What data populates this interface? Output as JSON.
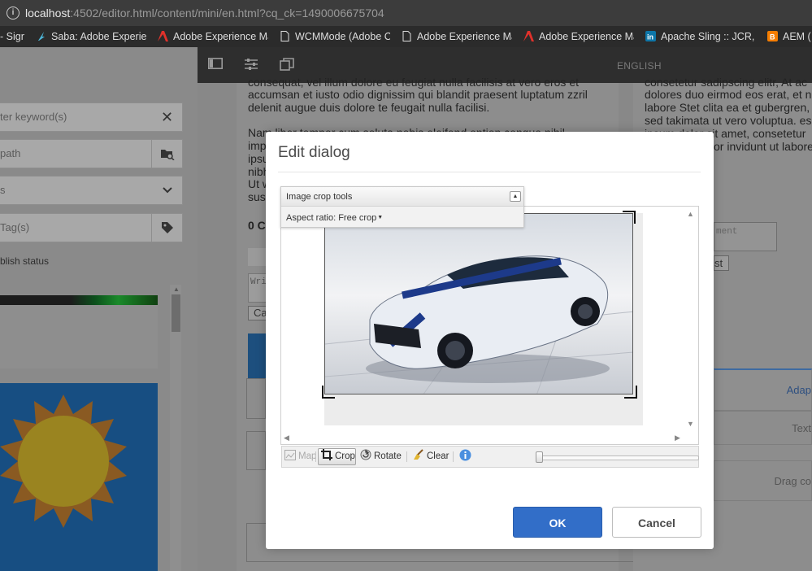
{
  "browser": {
    "url_host": "localhost",
    "url_path": ":4502/editor.html/content/mini/en.html?cq_ck=1490006675704",
    "bookmarks": [
      {
        "label": "- Sign",
        "icon": "none"
      },
      {
        "label": "Saba: Adobe Experien",
        "icon": "saba-icon"
      },
      {
        "label": "Adobe Experience Ma",
        "icon": "adobe-icon"
      },
      {
        "label": "WCMMode (Adobe C",
        "icon": "page-icon"
      },
      {
        "label": "Adobe Experience Ma",
        "icon": "page-icon"
      },
      {
        "label": "Adobe Experience Ma",
        "icon": "adobe-icon"
      },
      {
        "label": "Apache Sling :: JCR, OS",
        "icon": "linkedin-icon"
      },
      {
        "label": "AEM (",
        "icon": "blogger-icon"
      }
    ]
  },
  "sidebar": {
    "search_placeholder": "ter keyword(s)",
    "path_placeholder": "path",
    "select_value": "s",
    "tags_placeholder": "Tag(s)",
    "publish_status_label": "blish status"
  },
  "editor_bar": {
    "language": "ENGLISH"
  },
  "page": {
    "left_lines": [
      "consequat, vel illum dolore eu feugiat nulla facilisis at vero eros et",
      "accumsan et iusto odio dignissim qui blandit praesent luptatum zzril",
      "delenit augue duis dolore te feugait nulla facilisi.",
      "Nam liber tempor cum soluta nobis eleifend option congue nihil",
      "imp",
      "ipsu",
      "nibh",
      "Ut w",
      "sus"
    ],
    "comments_count": "0 C",
    "write_placeholder": "Wri",
    "cancel_label": "Ca",
    "right_lines": [
      "consetetur sadipscing elitr, At ac",
      "dolores duo eirmod eos erat, et n",
      "labore Stet clita ea et gubergren,",
      "sed takimata ut vero voluptua. es",
      "ipsum dolor sit amet, consetetur",
      "or invidunt ut labore"
    ],
    "comment_placeholder": "ment",
    "post_label": "st",
    "adapt_label": "Adap",
    "text_label": "Text",
    "drag_label": "Drag co"
  },
  "dialog": {
    "title": "Edit dialog",
    "crop_tools_title": "Image crop tools",
    "aspect_ratio_label": "Aspect ratio: Free crop",
    "toolbar": {
      "map": "Map",
      "crop": "Crop",
      "rotate": "Rotate",
      "clear": "Clear"
    },
    "zoom_level": 0,
    "ok_label": "OK",
    "cancel_label": "Cancel"
  }
}
